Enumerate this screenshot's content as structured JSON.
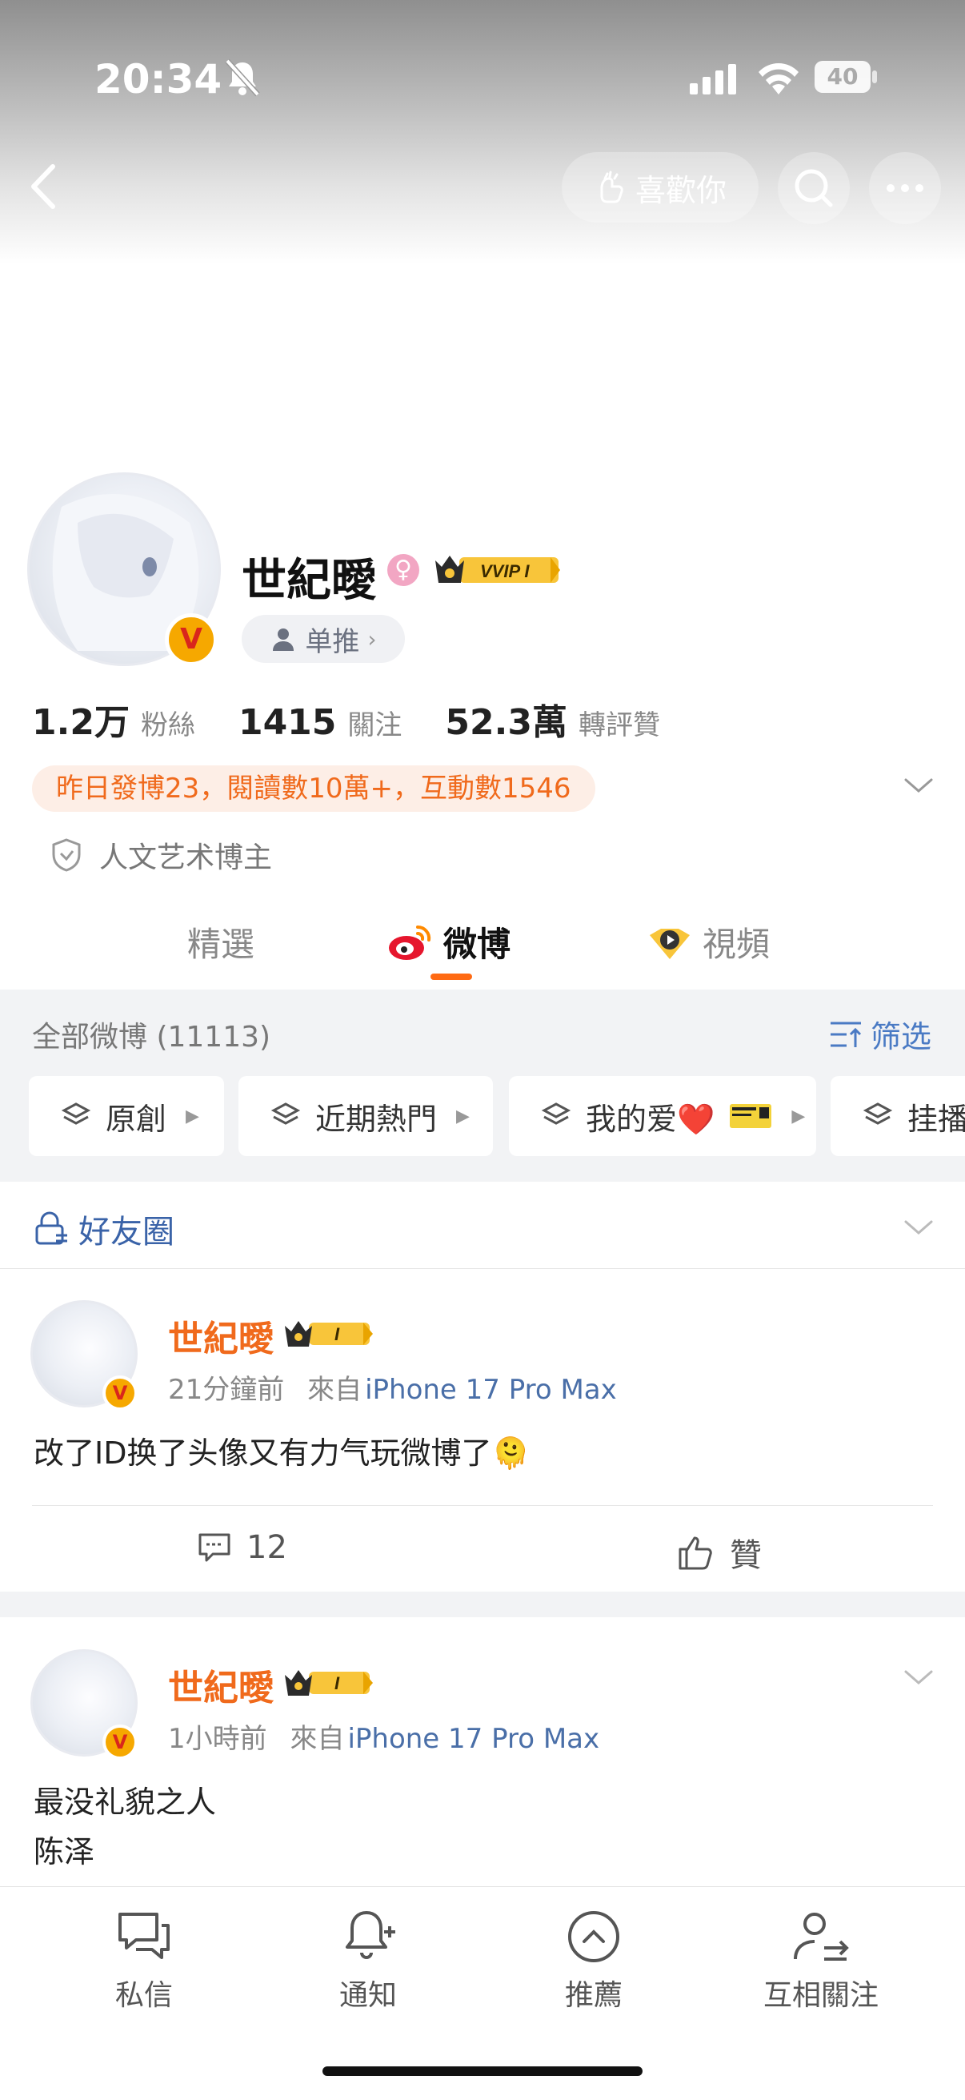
{
  "status_bar": {
    "time": "20:34",
    "battery": "40"
  },
  "header": {
    "like_label": "喜歡你"
  },
  "profile": {
    "name": "世紀曖",
    "gender_symbol": "♀",
    "vip_badge": "VVIP I",
    "verified_mark": "V",
    "single_label": "单推",
    "stats": [
      {
        "value": "1.2万",
        "label": "粉絲"
      },
      {
        "value": "1415",
        "label": "關注"
      },
      {
        "value": "52.3萬",
        "label": "轉評贊"
      }
    ],
    "activity": "昨日發博23，閱讀數10萬+，互動數1546",
    "tag": "人文艺术博主"
  },
  "tabs": [
    {
      "label": "精選",
      "active": false
    },
    {
      "label": "微博",
      "active": true
    },
    {
      "label": "視頻",
      "active": false
    }
  ],
  "filter": {
    "all_posts": "全部微博 (11113)",
    "filter_label": "筛选",
    "chips": [
      "原創",
      "近期熱門",
      "我的爱❤️",
      "挂播"
    ]
  },
  "friends_circle": "好友圈",
  "posts": [
    {
      "author": "世紀曖",
      "badge": "I",
      "time": "21分鐘前",
      "source_prefix": "來自",
      "device": "iPhone 17 Pro Max",
      "text": "改了ID换了头像又有力气玩微博了🫠",
      "comments": "12",
      "like_label": "贊"
    },
    {
      "author": "世紀曖",
      "badge": "I",
      "time": "1小時前",
      "source_prefix": "來自",
      "device": "iPhone 17 Pro Max",
      "text_lines": [
        "最没礼貌之人",
        "陈泽"
      ]
    }
  ],
  "bottom_nav": [
    {
      "label": "私信",
      "icon": "chat-icon"
    },
    {
      "label": "通知",
      "icon": "bell-plus-icon"
    },
    {
      "label": "推薦",
      "icon": "chevron-up-circle-icon"
    },
    {
      "label": "互相關注",
      "icon": "mutual-follow-icon"
    }
  ],
  "colors": {
    "accent": "#f06a1c",
    "link": "#4a6fa8",
    "tab_underline": "#ff6a13"
  }
}
